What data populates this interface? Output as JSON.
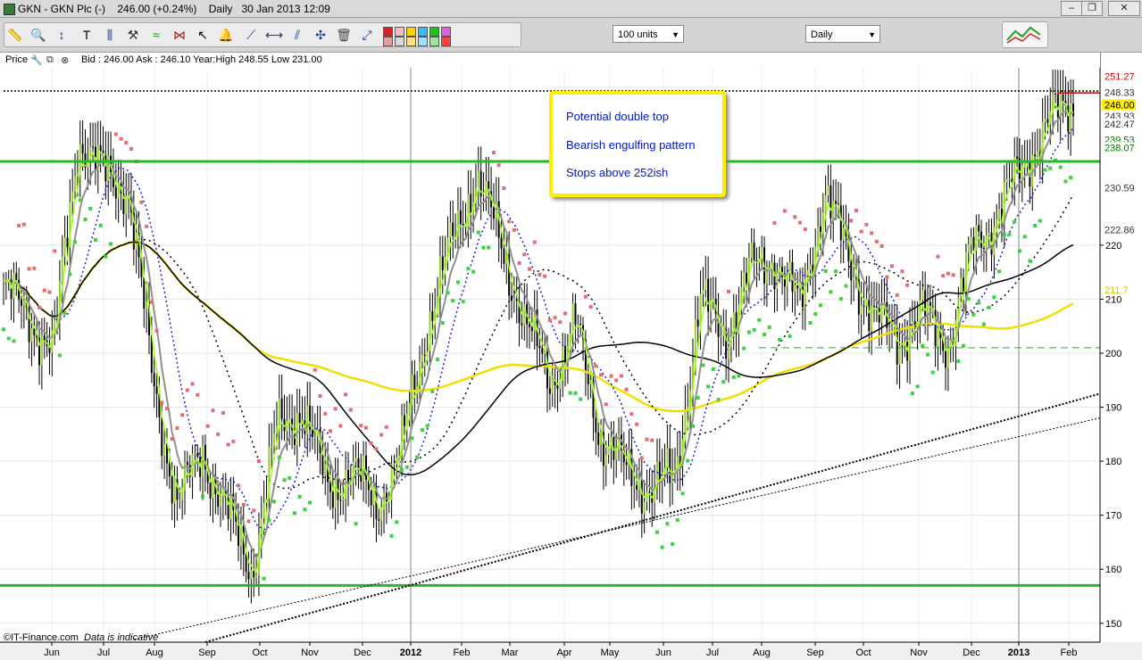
{
  "window": {
    "title_prefix": "GKN - GKN Plc (-)",
    "last": "246.00 (+0.24%)",
    "period_label": "Daily",
    "datetime": "30 Jan 2013 12:09"
  },
  "toolbar": {
    "units_value": "100 units",
    "interval_value": "Daily",
    "tools": [
      "ruler-icon",
      "zoom-icon",
      "crosshair-icon",
      "text-icon",
      "indicator-icon",
      "hammer-icon",
      "trend-icon",
      "trend2-icon",
      "cursor-icon",
      "bell-icon",
      "line-icon",
      "hline-icon",
      "channel-icon",
      "fib-icon",
      "trash-icon",
      "arrow-icon"
    ],
    "swatch_colors": [
      "#e02020",
      "#e0a0a0",
      "#f0c0c0",
      "#d8d8d8",
      "#ffd000",
      "#ffe080",
      "#30c0ff",
      "#9be0ff",
      "#20c020",
      "#a0e0a0",
      "#e060e0",
      "#ff4040"
    ]
  },
  "price_row": {
    "label": "Price",
    "bid_ask": "Bid : 246.00  Ask : 246.10  Year:High 248.55 Low 231.00"
  },
  "annotation": {
    "line1": "Potential double top",
    "line2": "Bearish engulfing pattern",
    "line3": "Stops above 252ish"
  },
  "footer": {
    "brand": "©IT-Finance.com",
    "disclaimer": "Data is indicative"
  },
  "chart_data": {
    "type": "candlestick",
    "title": "GKN - GKN Plc (-)",
    "frequency": "Daily",
    "ylim": [
      146.5,
      253
    ],
    "y_ticks": [
      150,
      160,
      170,
      180,
      190,
      200,
      210,
      220
    ],
    "x_labels": [
      "Jun",
      "Jul",
      "Aug",
      "Sep",
      "Oct",
      "Nov",
      "Dec",
      "2012",
      "Feb",
      "Mar",
      "Apr",
      "May",
      "Jun",
      "Jul",
      "Aug",
      "Sep",
      "Oct",
      "Nov",
      "Dec",
      "2013",
      "Feb"
    ],
    "price_labels": [
      {
        "value": 251.27,
        "text": "251.27",
        "color": "#cc0000",
        "bg": "#ffffff"
      },
      {
        "value": 248.33,
        "text": "248.33",
        "color": "#333333",
        "bg": "#ffffff"
      },
      {
        "value": 246.0,
        "text": "246.00",
        "color": "#000000",
        "bg": "#ffee00"
      },
      {
        "value": 243.93,
        "text": "243.93",
        "color": "#333333",
        "bg": "#ffffff"
      },
      {
        "value": 242.47,
        "text": "242.47",
        "color": "#333333",
        "bg": "#ffffff"
      },
      {
        "value": 239.53,
        "text": "239.53",
        "color": "#007700",
        "bg": "#ffffff"
      },
      {
        "value": 238.07,
        "text": "238.07",
        "color": "#007700",
        "bg": "#ffffff"
      },
      {
        "value": 230.59,
        "text": "230.59",
        "color": "#333333",
        "bg": "#ffffff"
      },
      {
        "value": 222.86,
        "text": "222.86",
        "color": "#333333",
        "bg": "#ffffff"
      },
      {
        "value": 211.7,
        "text": "211.7",
        "color": "#cccc00",
        "bg": "#ffffff"
      }
    ],
    "support_resistance": [
      {
        "name": "resistance",
        "value": 235.5,
        "color": "#22bb22"
      },
      {
        "name": "support",
        "value": 157,
        "color": "#22bb22"
      },
      {
        "name": "year-high",
        "value": 248.55,
        "color": "#000000"
      },
      {
        "name": "dashed-support",
        "value": 201,
        "color": "#22bb22"
      }
    ],
    "anchors_close": [
      [
        "Jun 2011",
        212
      ],
      [
        "mid-Jun",
        207
      ],
      [
        "late-Jun",
        200
      ],
      [
        "early-Jul",
        240
      ],
      [
        "mid-Jul",
        233
      ],
      [
        "late-Jul",
        231
      ],
      [
        "early-Aug",
        195
      ],
      [
        "mid-Aug",
        172
      ],
      [
        "Sep",
        182
      ],
      [
        "mid-Sep",
        170
      ],
      [
        "early-Oct",
        160
      ],
      [
        "mid-Oct",
        186
      ],
      [
        "Nov",
        190
      ],
      [
        "mid-Nov",
        175
      ],
      [
        "Dec",
        178
      ],
      [
        "mid-Dec",
        172
      ],
      [
        "2012",
        182
      ],
      [
        "late-Jan",
        205
      ],
      [
        "Feb",
        220
      ],
      [
        "early-Mar",
        233
      ],
      [
        "Mar",
        220
      ],
      [
        "Apr",
        205
      ],
      [
        "mid-Apr",
        195
      ],
      [
        "May",
        205
      ],
      [
        "mid-May",
        185
      ],
      [
        "Jun",
        178
      ],
      [
        "mid-Jun",
        175
      ],
      [
        "Jul",
        177
      ],
      [
        "mid-Jul",
        210
      ],
      [
        "Aug",
        203
      ],
      [
        "mid-Aug",
        215
      ],
      [
        "early-Sep",
        218
      ],
      [
        "mid-Sep",
        208
      ],
      [
        "late-Sep",
        230
      ],
      [
        "Oct",
        217
      ],
      [
        "mid-Oct",
        206
      ],
      [
        "Nov",
        203
      ],
      [
        "mid-Nov",
        207
      ],
      [
        "late-Nov",
        202
      ],
      [
        "Dec",
        220
      ],
      [
        "mid-Dec",
        226
      ],
      [
        "2013",
        235
      ],
      [
        "mid-Jan",
        243
      ],
      [
        "late-Jan",
        246
      ]
    ]
  }
}
